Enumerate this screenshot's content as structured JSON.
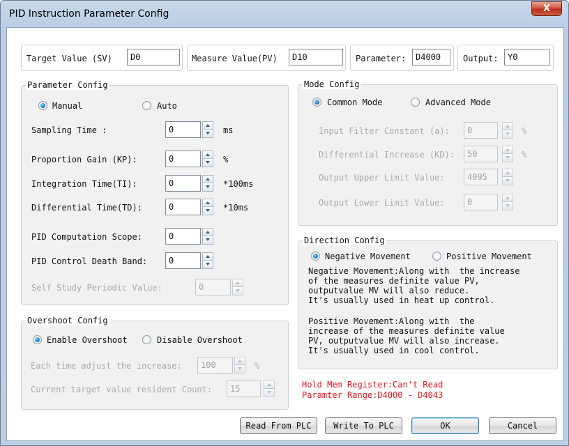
{
  "window": {
    "title": "PID Instruction Parameter Config",
    "close_glyph": "X"
  },
  "top": {
    "sv_label": "Target Value (SV)",
    "sv_value": "D0",
    "pv_label": "Measure Value(PV)",
    "pv_value": "D10",
    "param_label": "Parameter:",
    "param_value": "D4000",
    "output_label": "Output:",
    "output_value": "Y0"
  },
  "param_config": {
    "title": "Parameter Config",
    "manual_label": "Manual",
    "auto_label": "Auto",
    "selected": "Manual",
    "sampling_label": "Sampling Time :",
    "sampling_value": "0",
    "sampling_unit": "ms",
    "kp_label": "Proportion Gain (KP):",
    "kp_value": "0",
    "kp_unit": "%",
    "ti_label": "Integration Time(TI):",
    "ti_value": "0",
    "ti_unit": "*100ms",
    "td_label": "Differential Time(TD):",
    "td_value": "0",
    "td_unit": "*10ms",
    "scope_label": "PID Computation Scope:",
    "scope_value": "0",
    "deadband_label": "PID Control Death Band:",
    "deadband_value": "0",
    "selfstudy_label": "Self Study Periodic Value:",
    "selfstudy_value": "0"
  },
  "mode_config": {
    "title": "Mode Config",
    "common_label": "Common Mode",
    "advanced_label": "Advanced Mode",
    "selected": "Common Mode",
    "filter_label": "Input Filter Constant (a):",
    "filter_value": "0",
    "filter_unit": "%",
    "diffinc_label": "Differential Increase (KD):",
    "diffinc_value": "50",
    "diffinc_unit": "%",
    "upper_label": "Output Upper Limit Value:",
    "upper_value": "4095",
    "lower_label": "Output Lower Limit Value:",
    "lower_value": "0"
  },
  "direction_config": {
    "title": "Direction Config",
    "negative_label": "Negative Movement",
    "positive_label": "Positive Movement",
    "selected": "Negative Movement",
    "negative_desc": "Negative Movement:Along with  the increase\nof the measures definite value PV,\noutputvalue MV will also reduce.\nIt's usually used in heat up control.",
    "positive_desc": "Positive Movement:Along with  the\nincrease of the measures definite value\nPV, outputvalue MV will also increase.\nIt's usually used in cool control."
  },
  "overshoot_config": {
    "title": "Overshoot Config",
    "enable_label": "Enable Overshoot",
    "disable_label": "Disable Overshoot",
    "selected": "Enable Overshoot",
    "adjust_label": "Each time adjust the increase:",
    "adjust_value": "100",
    "adjust_unit": "%",
    "resident_label": "Current target value resident Count:",
    "resident_value": "15"
  },
  "status": {
    "line1": "Hold Mem Register:Can't Read",
    "line2": "Paramter Range:D4000 - D4043",
    "color": "#e0141d"
  },
  "buttons": {
    "read": "Read From PLC",
    "write": "Write To PLC",
    "ok": "OK",
    "cancel": "Cancel"
  }
}
